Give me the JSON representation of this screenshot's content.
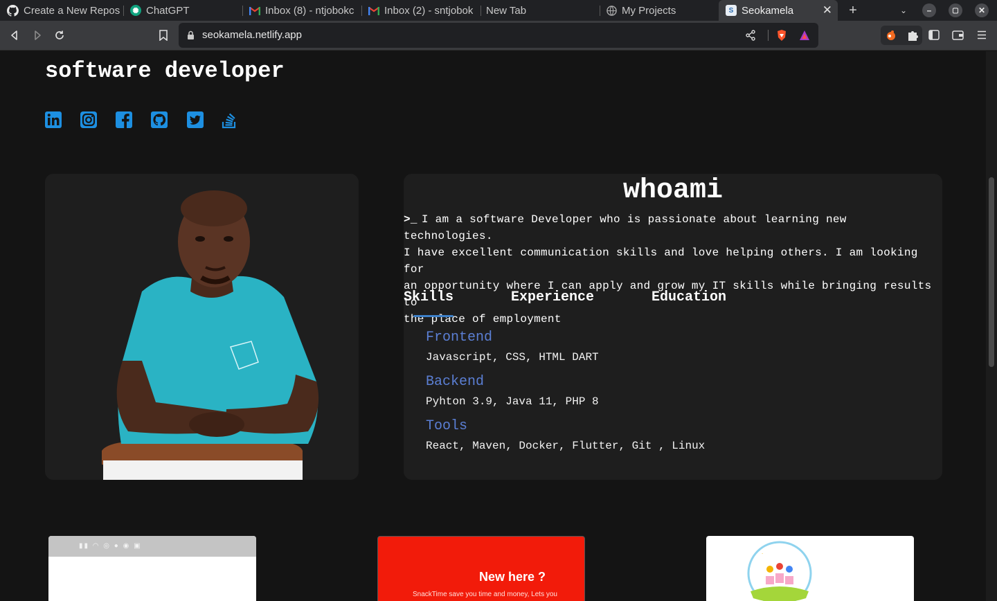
{
  "browser": {
    "tabs": [
      {
        "label": "Create a New Repos",
        "icon": "github-icon"
      },
      {
        "label": "ChatGPT",
        "icon": "chatgpt-icon"
      },
      {
        "label": "Inbox (8) - ntjobokc",
        "icon": "gmail-icon"
      },
      {
        "label": "Inbox (2) - sntjobok",
        "icon": "gmail-icon"
      },
      {
        "label": "New Tab",
        "icon": ""
      },
      {
        "label": "My Projects",
        "icon": "globe-icon"
      },
      {
        "label": "Seokamela",
        "icon": "site-favicon-icon",
        "active": true
      }
    ],
    "url": "seokamela.netlify.app"
  },
  "hero": {
    "role": "software developer",
    "socials": [
      "linkedin-icon",
      "instagram-icon",
      "facebook-icon",
      "github-icon",
      "twitter-icon",
      "stackoverflow-icon"
    ],
    "accent_color": "#1d8fe1"
  },
  "about": {
    "title": "whoami",
    "lines": [
      "I am a software Developer who is passionate about learning new technologies.",
      "I have excellent communication skills and love helping others. I am looking for",
      "an opportunity where I can apply and grow my IT skills while bringing results to",
      "the place of employment"
    ],
    "tabs": [
      "Skills",
      "Experience",
      "Education"
    ],
    "skills": [
      {
        "title": "Frontend",
        "items": "Javascript, CSS, HTML DART"
      },
      {
        "title": "Backend",
        "items": "Pyhton 3.9, Java 11, PHP 8"
      },
      {
        "title": "Tools",
        "items": "React, Maven, Docker, Flutter, Git , Linux"
      }
    ]
  },
  "projects": [
    {
      "caption": ""
    },
    {
      "headline": "New here ?",
      "subtext": "SnackTime save you time and money, Lets you"
    },
    {
      "caption": ""
    }
  ]
}
